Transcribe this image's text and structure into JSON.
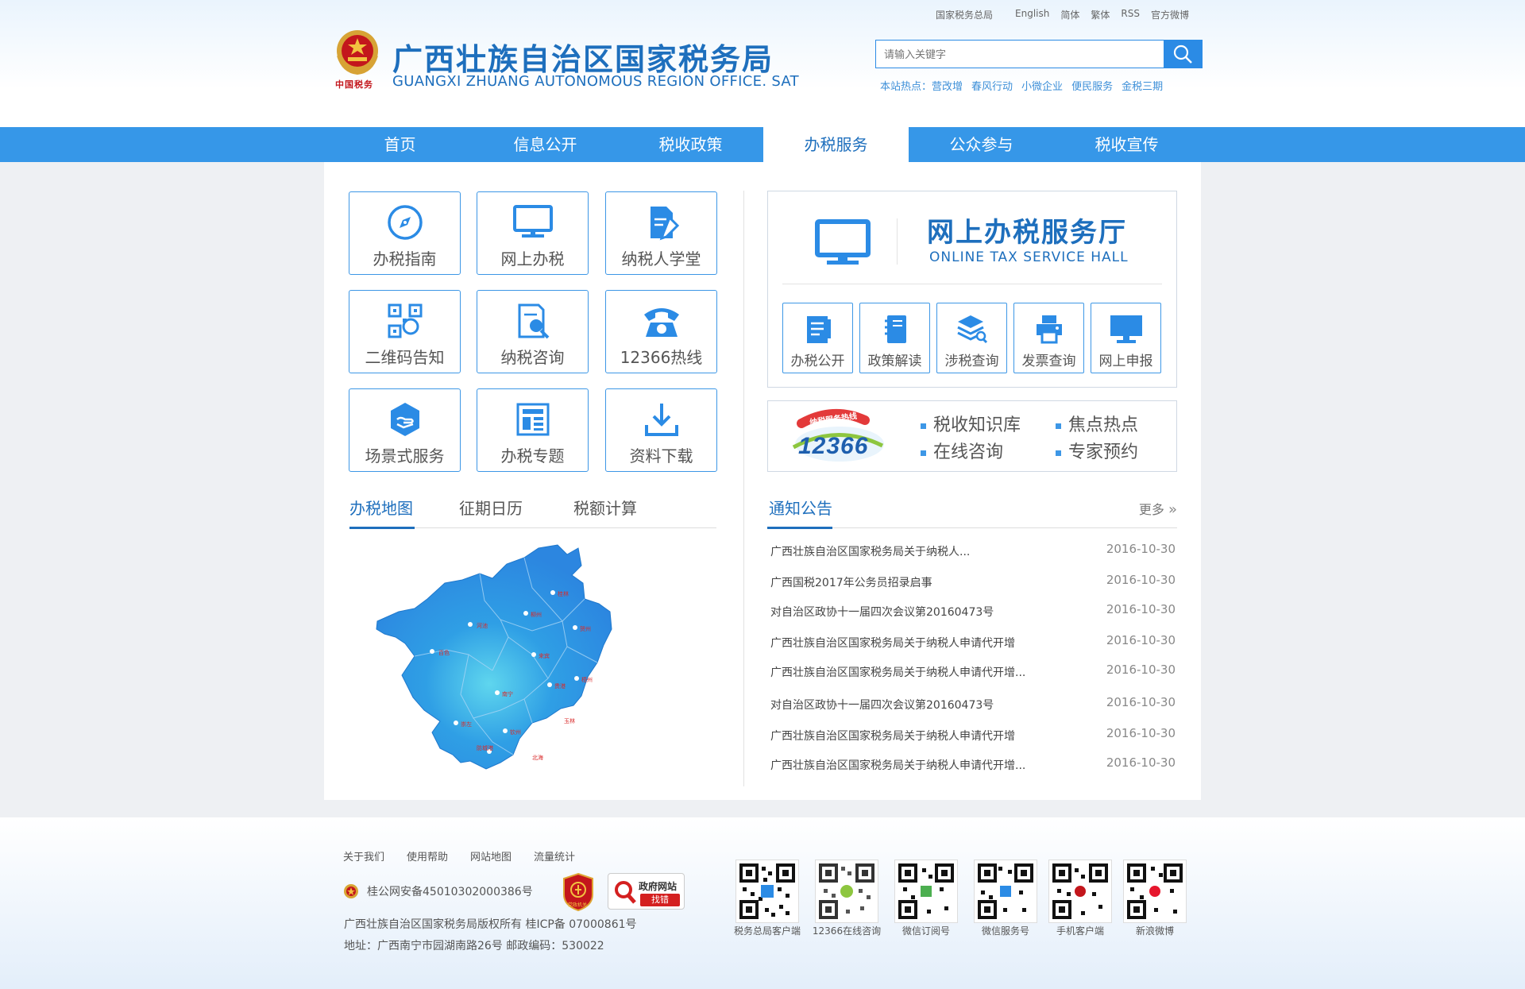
{
  "header": {
    "title": "广西壮族自治区国家税务局",
    "title_en": "GUANGXI ZHUANG AUTONOMOUS REGION OFFICE. SAT",
    "emblem_text": "中国税务",
    "top_links": [
      "国家税务总局",
      "English",
      "简体",
      "繁体",
      "RSS",
      "官方微博"
    ],
    "search_placeholder": "请输入关键字",
    "hot_label": "本站热点：",
    "hot_links": [
      "营改增",
      "春风行动",
      "小微企业",
      "便民服务",
      "金税三期"
    ]
  },
  "nav": {
    "items": [
      "首页",
      "信息公开",
      "税收政策",
      "办税服务",
      "公众参与",
      "税收宣传"
    ],
    "active_index": 3
  },
  "services": [
    {
      "label": "办税指南",
      "icon": "compass-icon"
    },
    {
      "label": "网上办税",
      "icon": "monitor-icon"
    },
    {
      "label": "纳税人学堂",
      "icon": "document-pen-icon"
    },
    {
      "label": "二维码告知",
      "icon": "qrcode-icon"
    },
    {
      "label": "纳税咨询",
      "icon": "document-search-icon"
    },
    {
      "label": "12366热线",
      "icon": "telephone-icon"
    },
    {
      "label": "场景式服务",
      "icon": "hand-box-icon"
    },
    {
      "label": "办税专题",
      "icon": "layout-icon"
    },
    {
      "label": "资料下载",
      "icon": "download-icon"
    }
  ],
  "hall": {
    "title": "网上办税服务厅",
    "title_en": "ONLINE TAX SERVICE HALL",
    "items": [
      {
        "label": "办税公开",
        "icon": "notepad-icon"
      },
      {
        "label": "政策解读",
        "icon": "book-icon"
      },
      {
        "label": "涉税查询",
        "icon": "layers-search-icon"
      },
      {
        "label": "发票查询",
        "icon": "printer-icon"
      },
      {
        "label": "网上申报",
        "icon": "monitor-icon"
      }
    ]
  },
  "hotline": {
    "logo_text": "纳税服务热线",
    "logo_number": "12366",
    "links": [
      "税收知识库",
      "焦点热点",
      "在线咨询",
      "专家预约"
    ]
  },
  "map_tabs": {
    "tabs": [
      "办税地图",
      "征期日历",
      "税额计算"
    ],
    "active_index": 0,
    "cities": [
      "桂林",
      "柳州",
      "河池",
      "百色",
      "贺州",
      "来宾",
      "梧州",
      "南宁",
      "贵港",
      "崇左",
      "玉林",
      "钦州",
      "防城港",
      "北海"
    ]
  },
  "notices": {
    "title": "通知公告",
    "more": "更多",
    "items": [
      {
        "title": "广西壮族自治区国家税务局关于纳税人...",
        "date": "2016-10-30"
      },
      {
        "title": "广西国税2017年公务员招录启事",
        "date": "2016-10-30"
      },
      {
        "title": "对自治区政协十一届四次会议第20160473号",
        "date": "2016-10-30"
      },
      {
        "title": "广西壮族自治区国家税务局关于纳税人申请代开增",
        "date": "2016-10-30"
      },
      {
        "title": "广西壮族自治区国家税务局关于纳税人申请代开增...",
        "date": "2016-10-30"
      },
      {
        "title": "对自治区政协十一届四次会议第20160473号",
        "date": "2016-10-30"
      },
      {
        "title": "广西壮族自治区国家税务局关于纳税人申请代开增",
        "date": "2016-10-30"
      },
      {
        "title": "广西壮族自治区国家税务局关于纳税人申请代开增...",
        "date": "2016-10-30"
      }
    ]
  },
  "footer": {
    "links": [
      "关于我们",
      "使用帮助",
      "网站地图",
      "流量统计"
    ],
    "police": "桂公网安备45010302000386号",
    "copyright": "广西壮族自治区国家税务局版权所有 桂ICP备 07000861号",
    "address": "地址：广西南宁市园湖南路26号  邮政编码：530022",
    "badge1_text": "党政机关",
    "badge2_line1": "政府网站",
    "badge2_line2": "找错",
    "qrcodes": [
      "税务总局客户端",
      "12366在线咨询",
      "微信订阅号",
      "微信服务号",
      "手机客户端",
      "新浪微博"
    ]
  }
}
